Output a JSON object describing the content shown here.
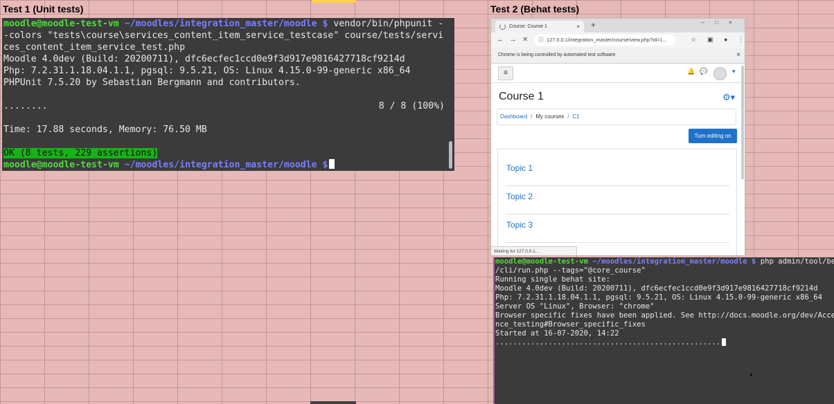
{
  "headings": {
    "test1": "Test 1 (Unit tests)",
    "test2": "Test 2 (Behat tests)"
  },
  "terminal1": {
    "prompt_user": "moodle@moodle-test-vm",
    "prompt_path": "~/moodles/integration_master/moodle $",
    "command_line1": " vendor/bin/phpunit -",
    "command_line2": "-colors \"tests\\course\\services_content_item_service_testcase\" course/tests/servi",
    "command_line3": "ces_content_item_service_test.php",
    "version": "Moodle 4.0dev (Build: 20200711), dfc6ecfec1ccd0e9f3d917e9816427718cf9214d",
    "php": "Php: 7.2.31.1.18.04.1.1, pgsql: 9.5.21, OS: Linux 4.15.0-99-generic x86_64",
    "phpunit": "PHPUnit 7.5.20 by Sebastian Bergmann and contributors.",
    "progress_dots": "........",
    "progress_count": "8 / 8 (100%)",
    "time": "Time: 17.88 seconds, Memory: 76.50 MB",
    "ok": "OK (8 tests, 229 assertions)"
  },
  "browser": {
    "tab_title": "Course: Course 1",
    "tab_close": "×",
    "new_tab": "+",
    "win_min": "–",
    "win_max": "□",
    "win_close": "×",
    "back": "←",
    "forward": "→",
    "stop": "✕",
    "info_icon": "ⓘ",
    "url": "127.0.0.1/integration_master/course/view.php?id=1...",
    "star": "☆",
    "ext": "▣",
    "account": "●",
    "menu": "⋮",
    "infobar_text": "Chrome is being controlled by automated test software.",
    "infobar_close": "×",
    "hamburger": "≡",
    "bell": "🔔",
    "chat": "💬",
    "caret": "▾",
    "page_title": "Course 1",
    "gear": "⚙▾",
    "breadcrumb": [
      "Dashboard",
      "My courses",
      "C1"
    ],
    "breadcrumb_sep": "/",
    "edit_button": "Turn editing on",
    "topics": [
      "Topic 1",
      "Topic 2",
      "Topic 3"
    ],
    "status": "Waiting for 127.0.0.1..."
  },
  "terminal2": {
    "prompt_user": "moodle@moodle-test-vm",
    "prompt_path": "~/moodles/integration_master/moodle $",
    "command_line1": " php admin/tool/behat",
    "command_line2": "/cli/run.php --tags=\"@core_course\"",
    "lines": [
      "Running single behat site:",
      "Moodle 4.0dev (Build: 20200711), dfc6ecfec1ccd0e9f3d917e9816427718cf9214d",
      "Php: 7.2.31.1.18.04.1.1, pgsql: 9.5.21, OS: Linux 4.15.0-99-generic x86_64",
      "Server OS \"Linux\", Browser: \"chrome\"",
      "Browser specific fixes have been applied. See http://docs.moodle.org/dev/Accepta",
      "nce_testing#Browser_specific_fixes",
      "Started at 16-07-2020, 14:22"
    ],
    "progress": "..................................................."
  },
  "colors": {
    "background": "#e6b8b8",
    "terminal_bg": "#3b3b3b",
    "prompt_user": "#4fdc3d",
    "prompt_path": "#7d7dff",
    "ok_bg": "#17b217",
    "moodle_blue": "#1f72c9"
  }
}
